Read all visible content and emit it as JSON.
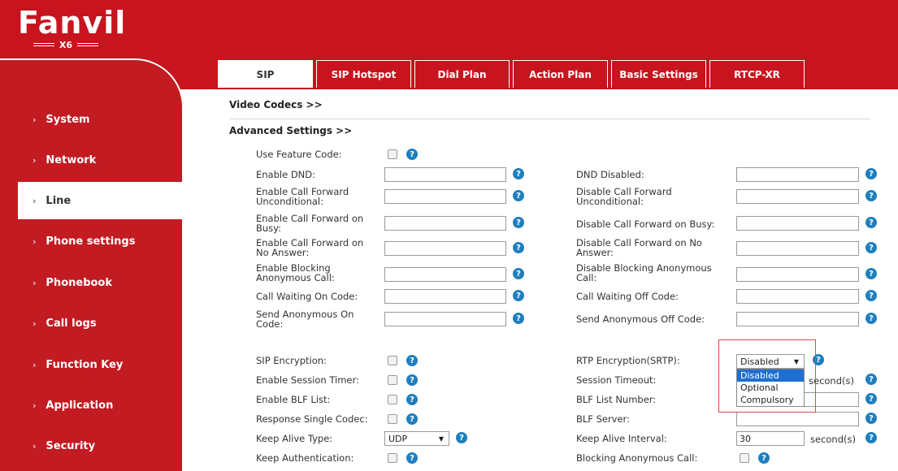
{
  "brand": {
    "name": "Fanvil",
    "model": "X6"
  },
  "sidebar": {
    "items": [
      {
        "label": "System"
      },
      {
        "label": "Network"
      },
      {
        "label": "Line"
      },
      {
        "label": "Phone settings"
      },
      {
        "label": "Phonebook"
      },
      {
        "label": "Call logs"
      },
      {
        "label": "Function Key"
      },
      {
        "label": "Application"
      },
      {
        "label": "Security"
      }
    ],
    "active": "Line"
  },
  "tabs": [
    {
      "label": "SIP"
    },
    {
      "label": "SIP Hotspot"
    },
    {
      "label": "Dial Plan"
    },
    {
      "label": "Action Plan"
    },
    {
      "label": "Basic Settings"
    },
    {
      "label": "RTCP-XR"
    }
  ],
  "sections": {
    "video_codecs": "Video Codecs >>",
    "advanced_settings": "Advanced Settings >>"
  },
  "fields": {
    "use_feature_code": "Use Feature Code:",
    "enable_dnd": "Enable DND:",
    "dnd_disabled": "DND Disabled:",
    "enable_cf_uncond": "Enable Call Forward Unconditional:",
    "disable_cf_uncond": "Disable Call Forward Unconditional:",
    "enable_cf_busy": "Enable Call Forward on Busy:",
    "disable_cf_busy": "Disable Call Forward on Busy:",
    "enable_cf_noanswer": "Enable Call Forward on No Answer:",
    "disable_cf_noanswer": "Disable Call Forward on No Answer:",
    "enable_block_anon": "Enable Blocking Anonymous Call:",
    "disable_block_anon": "Disable Blocking Anonymous Call:",
    "cw_on": "Call Waiting On Code:",
    "cw_off": "Call Waiting Off Code:",
    "send_anon_on": "Send Anonymous On Code:",
    "send_anon_off": "Send Anonymous Off Code:",
    "sip_encryption": "SIP Encryption:",
    "rtp_encryption": "RTP Encryption(SRTP):",
    "session_timer": "Enable Session Timer:",
    "session_timeout": "Session Timeout:",
    "blf_list": "Enable BLF List:",
    "blf_list_number": "BLF List Number:",
    "response_single_codec": "Response Single Codec:",
    "blf_server": "BLF Server:",
    "keep_alive_type": "Keep Alive Type:",
    "keep_alive_interval": "Keep Alive Interval:",
    "keep_auth": "Keep Authentication:",
    "blocking_anon": "Blocking Anonymous Call:"
  },
  "values": {
    "rtp_encryption_selected": "Disabled",
    "rtp_encryption_options": [
      "Disabled",
      "Optional",
      "Compulsory"
    ],
    "keep_alive_type": "UDP",
    "keep_alive_interval": "30",
    "seconds_unit": "second(s)"
  },
  "colors": {
    "brand_red": "#c8141e",
    "help_blue": "#1f7fbd",
    "highlight": "#e0454a"
  }
}
